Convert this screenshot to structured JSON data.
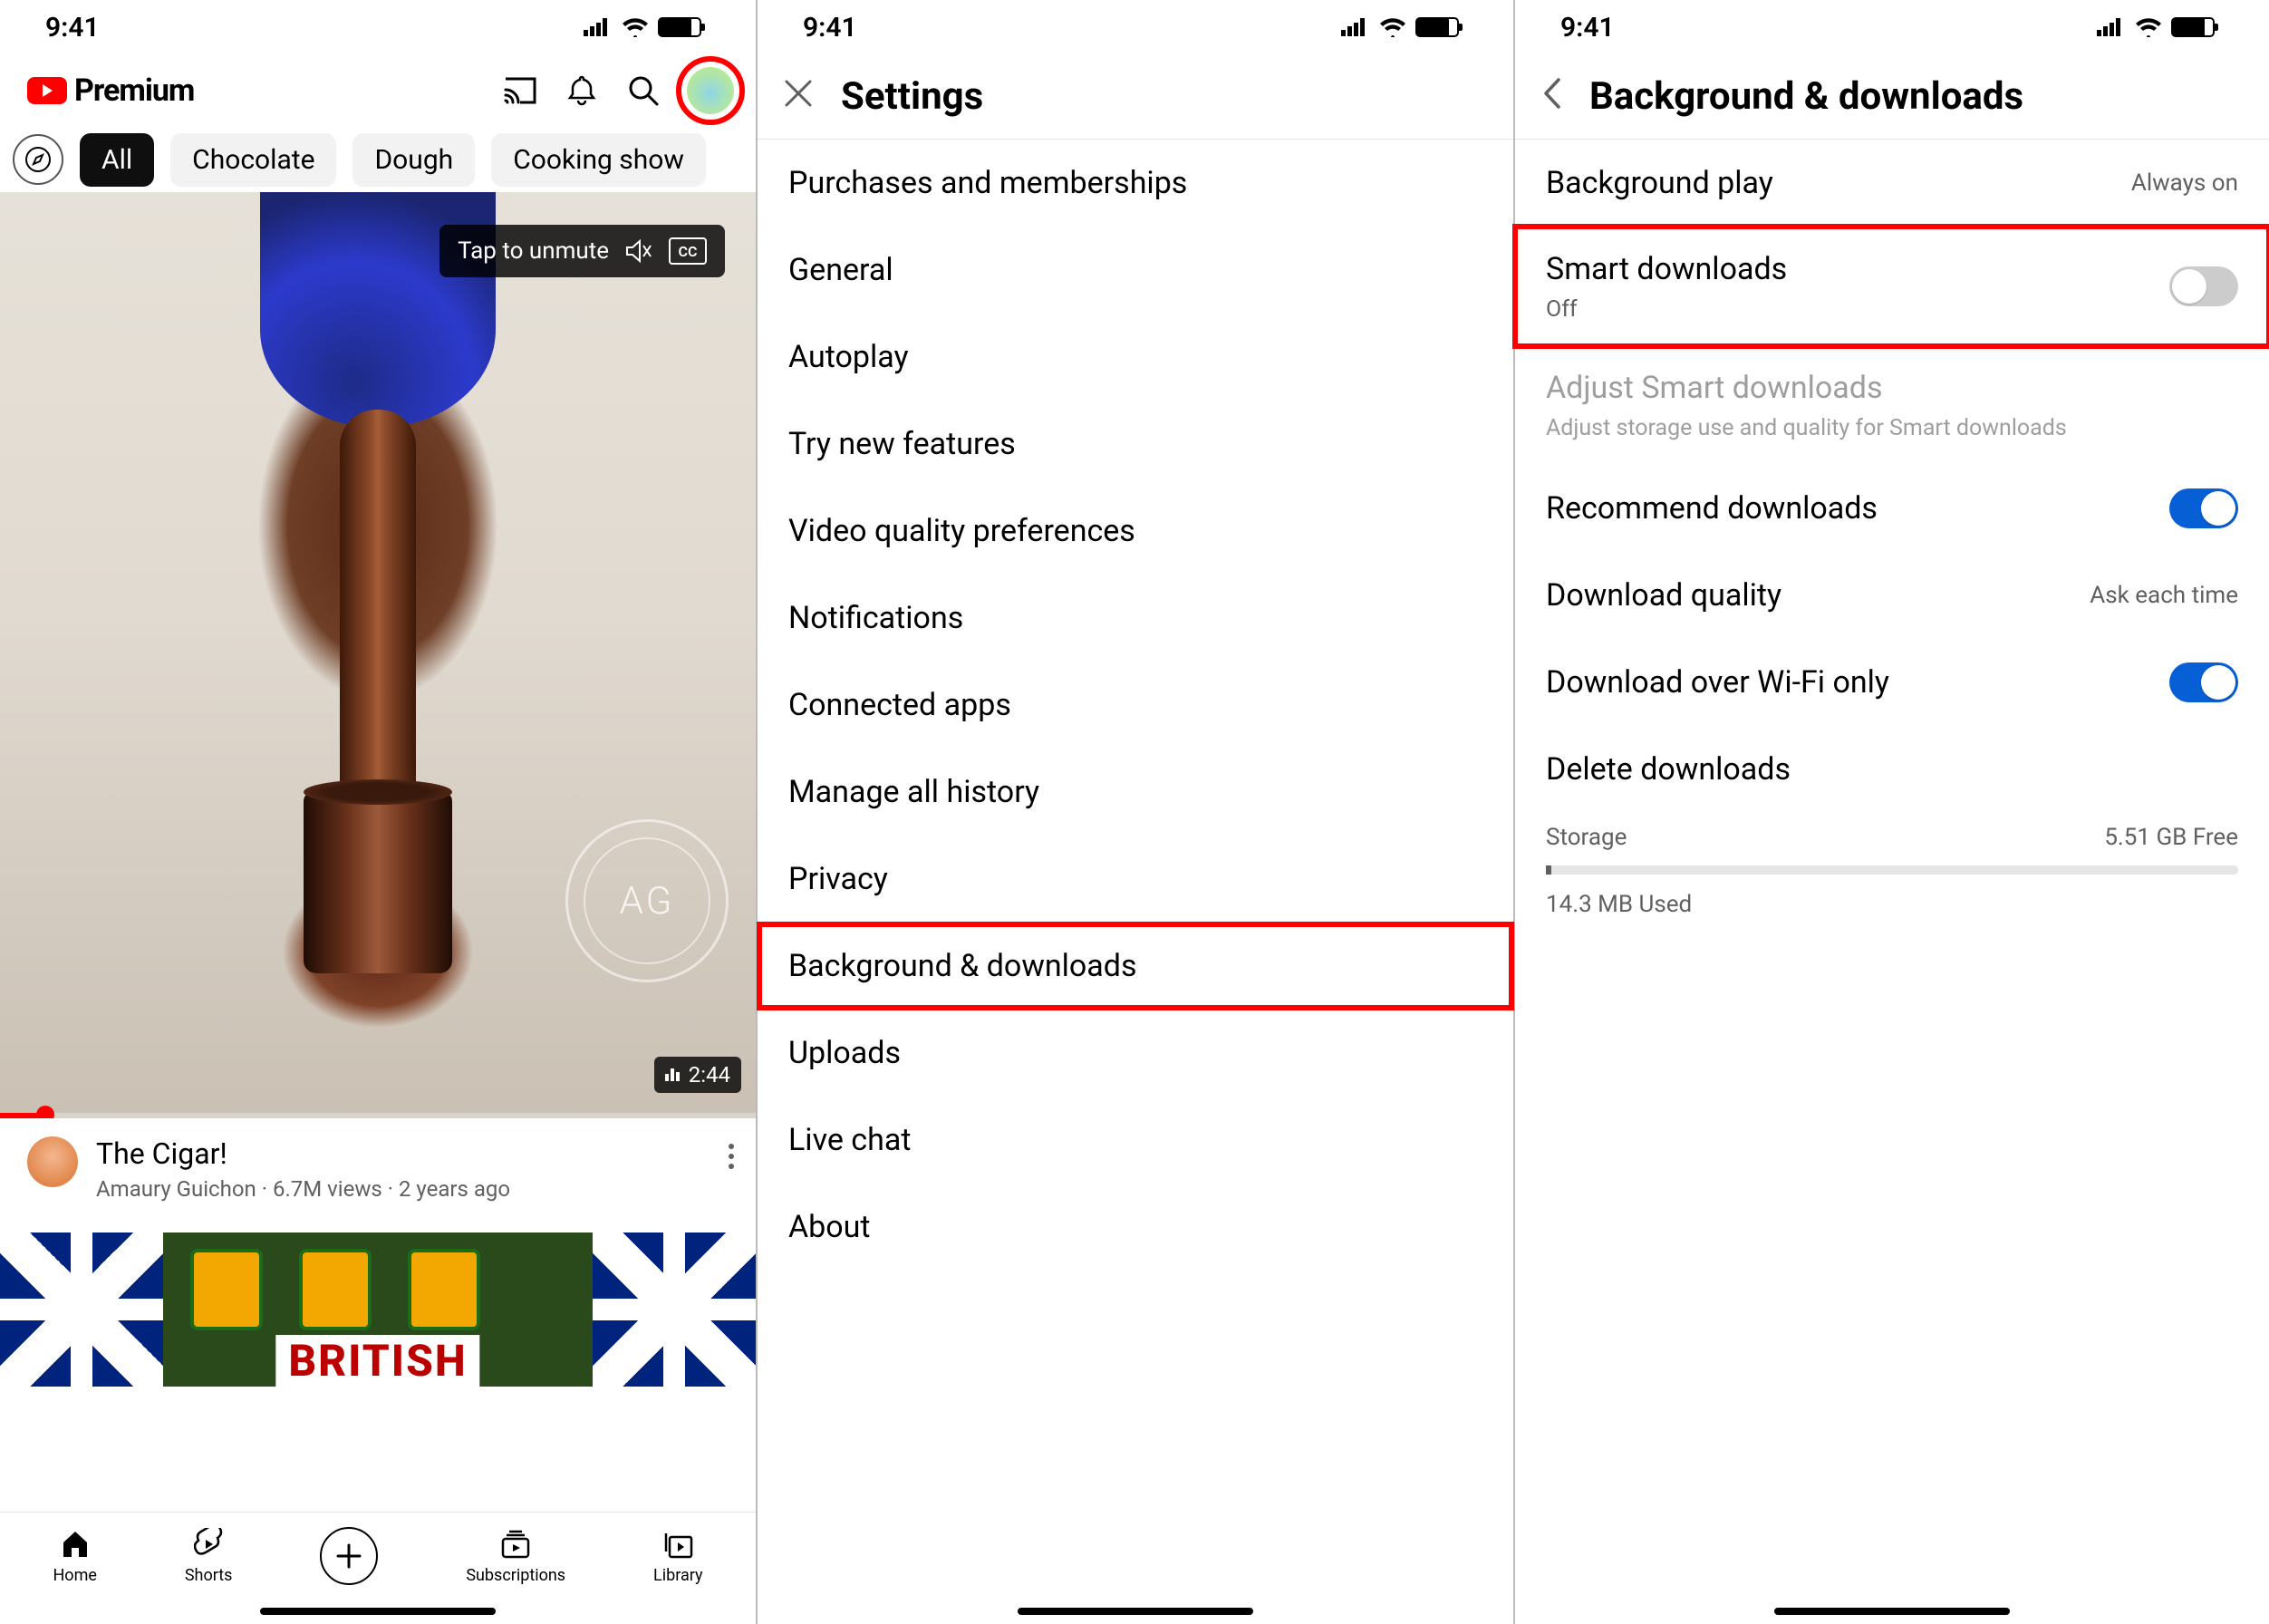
{
  "status": {
    "time": "9:41"
  },
  "screen1": {
    "premium_text": "Premium",
    "chips": {
      "all": "All",
      "chocolate": "Chocolate",
      "dough": "Dough",
      "cooking": "Cooking show"
    },
    "unmute": "Tap to unmute",
    "cc": "CC",
    "duration": "2:44",
    "video": {
      "title": "The Cigar!",
      "meta": "Amaury Guichon · 6.7M views · 2 years ago"
    },
    "thumb2_text": "BRITISH",
    "nav": {
      "home": "Home",
      "shorts": "Shorts",
      "subscriptions": "Subscriptions",
      "library": "Library"
    }
  },
  "screen2": {
    "title": "Settings",
    "items": {
      "purchases": "Purchases and memberships",
      "general": "General",
      "autoplay": "Autoplay",
      "try_new": "Try new features",
      "video_quality": "Video quality preferences",
      "notifications": "Notifications",
      "connected": "Connected apps",
      "history": "Manage all history",
      "privacy": "Privacy",
      "bg_dl": "Background & downloads",
      "uploads": "Uploads",
      "live_chat": "Live chat",
      "about": "About"
    }
  },
  "screen3": {
    "title": "Background & downloads",
    "bg_play": {
      "label": "Background play",
      "value": "Always on"
    },
    "smart": {
      "label": "Smart downloads",
      "sub": "Off"
    },
    "adjust": {
      "label": "Adjust Smart downloads",
      "sub": "Adjust storage use and quality for Smart downloads"
    },
    "recommend": "Recommend downloads",
    "quality": {
      "label": "Download quality",
      "value": "Ask each time"
    },
    "wifi": "Download over Wi-Fi only",
    "delete": "Delete downloads",
    "storage": {
      "label": "Storage",
      "free": "5.51 GB Free",
      "used": "14.3 MB Used"
    }
  }
}
